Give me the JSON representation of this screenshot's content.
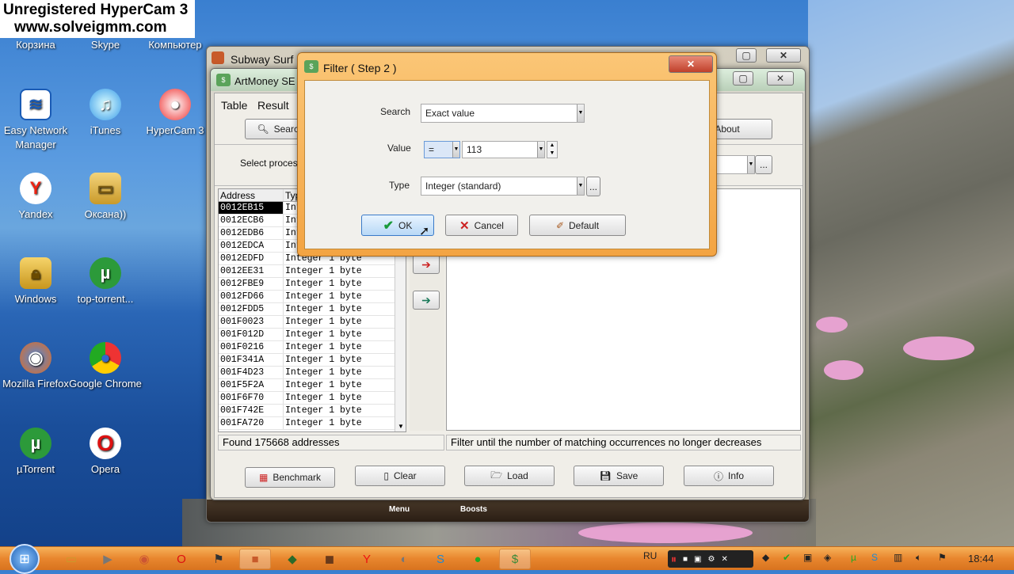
{
  "watermark": {
    "line1": "Unregistered HyperCam 3",
    "line2": "www.solveigmm.com"
  },
  "desktop_icons": [
    {
      "label": "Корзина"
    },
    {
      "label": "Skype"
    },
    {
      "label": "Компьютер"
    },
    {
      "label": "Easy Network Manager"
    },
    {
      "label": "iTunes"
    },
    {
      "label": "HyperCam 3"
    },
    {
      "label": "Yandex"
    },
    {
      "label": "Оксана))"
    },
    {
      "label": "Windows"
    },
    {
      "label": "top-torrent..."
    },
    {
      "label": "Mozilla Firefox"
    },
    {
      "label": "Google Chrome"
    },
    {
      "label": "µTorrent"
    },
    {
      "label": "Opera"
    }
  ],
  "subway": {
    "title": "Subway Surf",
    "bottom_menu": "Menu",
    "bottom_boosts": "Boosts"
  },
  "artmoney": {
    "title": "ArtMoney SE",
    "menu": [
      "Table",
      "Result"
    ],
    "search_label": "Search",
    "about_label": "About",
    "select_process_label": "Select process",
    "columns": {
      "address": "Address",
      "type": "Type"
    },
    "rows": [
      {
        "address": "0012EB15",
        "type": "Integer 1 byte"
      },
      {
        "address": "0012ECB6",
        "type": "Integer 1 byte"
      },
      {
        "address": "0012EDB6",
        "type": "Integer 1 byte"
      },
      {
        "address": "0012EDCA",
        "type": "Integer 1 byte"
      },
      {
        "address": "0012EDFD",
        "type": "Integer 1 byte"
      },
      {
        "address": "0012EE31",
        "type": "Integer 1 byte"
      },
      {
        "address": "0012FBE9",
        "type": "Integer 1 byte"
      },
      {
        "address": "0012FD66",
        "type": "Integer 1 byte"
      },
      {
        "address": "0012FDD5",
        "type": "Integer 1 byte"
      },
      {
        "address": "001F0023",
        "type": "Integer 1 byte"
      },
      {
        "address": "001F012D",
        "type": "Integer 1 byte"
      },
      {
        "address": "001F0216",
        "type": "Integer 1 byte"
      },
      {
        "address": "001F341A",
        "type": "Integer 1 byte"
      },
      {
        "address": "001F4D23",
        "type": "Integer 1 byte"
      },
      {
        "address": "001F5F2A",
        "type": "Integer 1 byte"
      },
      {
        "address": "001F6F70",
        "type": "Integer 1 byte"
      },
      {
        "address": "001F742E",
        "type": "Integer 1 byte"
      },
      {
        "address": "001FA720",
        "type": "Integer 1 byte"
      }
    ],
    "found_text": "Found 175668 addresses",
    "hint_text": "Filter until the number of matching occurrences no longer decreases",
    "buttons": {
      "benchmark": "Benchmark",
      "clear": "Clear",
      "load": "Load",
      "save": "Save",
      "info": "Info"
    }
  },
  "filter": {
    "title": "Filter ( Step 2 )",
    "search_label": "Search",
    "search_value": "Exact value",
    "value_label": "Value",
    "operator": "=",
    "value": "113",
    "type_label": "Type",
    "type_value": "Integer (standard)",
    "ok": "OK",
    "cancel": "Cancel",
    "default": "Default"
  },
  "taskbar": {
    "lang": "RU",
    "clock": "18:44"
  }
}
